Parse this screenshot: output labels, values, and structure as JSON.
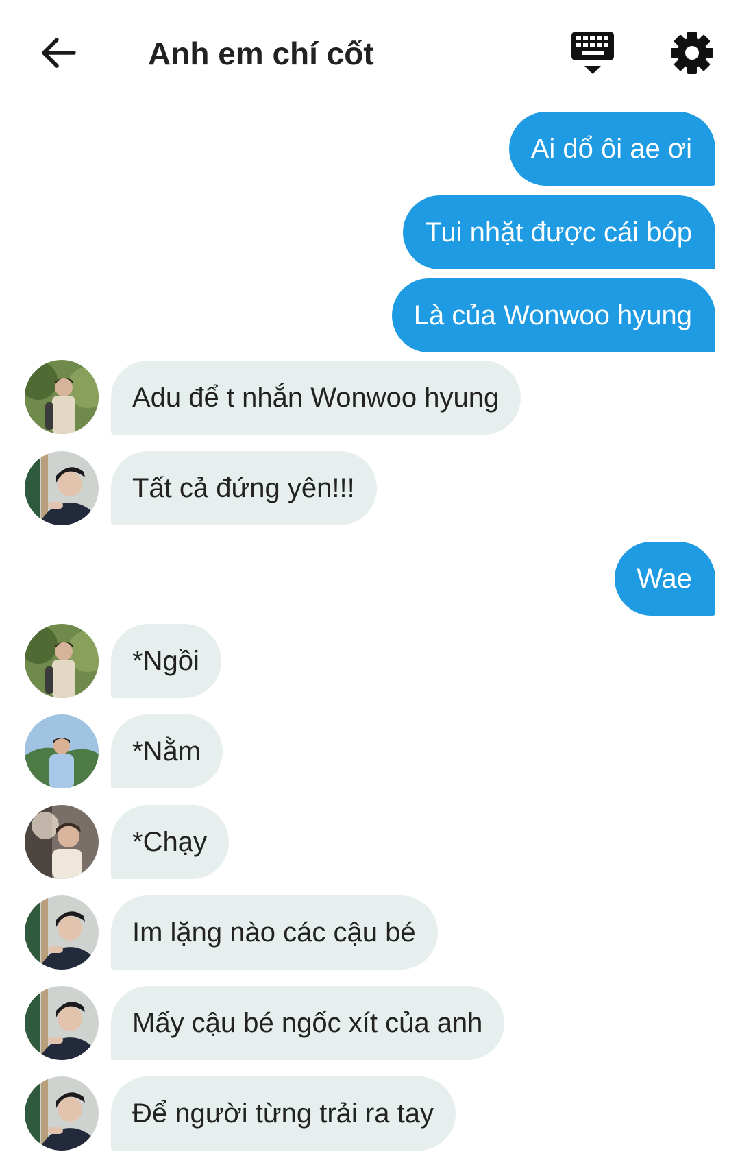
{
  "header": {
    "title": "Anh em chí cốt",
    "back_icon": "arrow-left-icon",
    "keyboard_icon": "keyboard-hide-icon",
    "settings_icon": "gear-icon"
  },
  "colors": {
    "outgoing_bubble": "#1e9be3",
    "incoming_bubble": "#e6eeee",
    "background": "#ffffff"
  },
  "messages": [
    {
      "direction": "out",
      "text": "Ai dổ ôi ae ơi"
    },
    {
      "direction": "out",
      "text": "Tui nhặt được cái bóp"
    },
    {
      "direction": "out",
      "text": "Là của Wonwoo hyung"
    },
    {
      "direction": "in",
      "avatar": "avatar-a",
      "text": "Adu để t nhắn Wonwoo hyung"
    },
    {
      "direction": "in",
      "avatar": "avatar-b",
      "text": "Tất cả đứng yên!!!"
    },
    {
      "direction": "out",
      "text": "Wae"
    },
    {
      "direction": "in",
      "avatar": "avatar-a",
      "text": "*Ngồi"
    },
    {
      "direction": "in",
      "avatar": "avatar-c",
      "text": "*Nằm"
    },
    {
      "direction": "in",
      "avatar": "avatar-d",
      "text": "*Chạy"
    },
    {
      "direction": "in",
      "avatar": "avatar-b",
      "text": "Im lặng nào các cậu bé"
    },
    {
      "direction": "in",
      "avatar": "avatar-b",
      "text": "Mấy cậu bé ngốc xít của anh"
    },
    {
      "direction": "in",
      "avatar": "avatar-b",
      "text": "Để người từng trải ra tay"
    }
  ]
}
